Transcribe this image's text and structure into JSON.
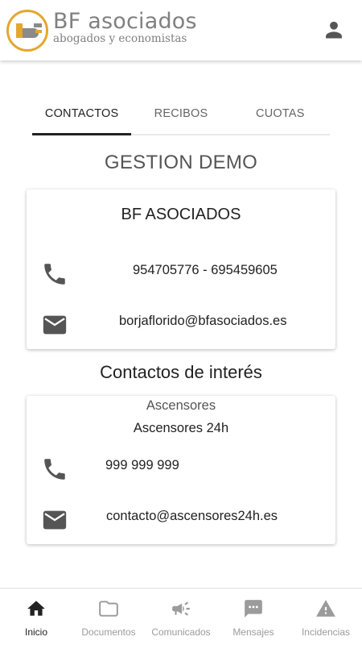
{
  "header": {
    "brand_name": "BF asociados",
    "brand_tagline": "abogados y economistas",
    "account_icon": "person-icon",
    "accent_color": "#e3a72f"
  },
  "tabs": [
    {
      "label": "CONTACTOS",
      "active": true
    },
    {
      "label": "RECIBOS",
      "active": false
    },
    {
      "label": "CUOTAS",
      "active": false
    }
  ],
  "community_title": "GESTION DEMO",
  "admin_card": {
    "title": "BF ASOCIADOS",
    "phone": "954705776 - 695459605",
    "email": "borjaflorido@bfasociados.es",
    "phone_icon": "phone-icon",
    "email_icon": "mail-icon"
  },
  "interest_title": "Contactos de interés",
  "interest_contacts": [
    {
      "category": "Ascensores",
      "name": "Ascensores 24h",
      "phone": "999 999 999",
      "email": "contacto@ascensores24h.es"
    }
  ],
  "bottom_nav": [
    {
      "label": "Inicio",
      "icon": "home-icon",
      "active": true
    },
    {
      "label": "Documentos",
      "icon": "folder-icon",
      "active": false
    },
    {
      "label": "Comunicados",
      "icon": "megaphone-icon",
      "active": false
    },
    {
      "label": "Mensajes",
      "icon": "chat-icon",
      "active": false
    },
    {
      "label": "Incidencias",
      "icon": "warning-icon",
      "active": false
    }
  ]
}
